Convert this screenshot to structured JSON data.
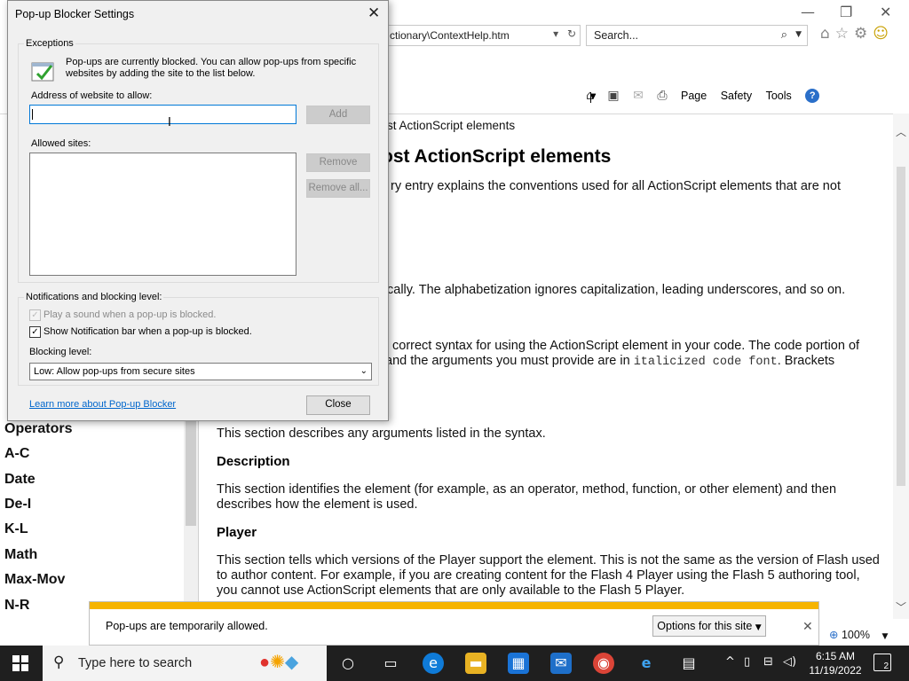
{
  "browser": {
    "address": "ctionary\\ContextHelp.htm",
    "search_placeholder": "Search...",
    "command_bar": {
      "page": "Page",
      "safety": "Safety",
      "tools": "Tools"
    },
    "zoom": "100%"
  },
  "left_nav": {
    "items": [
      "Operators",
      "A-C",
      "Date",
      "De-I",
      "K-L",
      "Math",
      "Max-Mov",
      "N-R"
    ]
  },
  "content": {
    "breadcrumb": "st ActionScript elements",
    "heading": "ost ActionScript elements",
    "p1": "ry entry explains the conventions used for all ActionScript elements that are not",
    "p2": "cally. The alphabetization ignores capitalization, leading underscores, and so on.",
    "p3a": "correct syntax for using the ActionScript element in your code. The code portion of",
    "p3b_pre": "and the arguments you must provide are in ",
    "p3b_code": "italicized code font",
    "p3b_post": ". Brackets",
    "p4": "This section describes any arguments listed in the syntax.",
    "h_description": "Description",
    "p5": "This section identifies the element (for example, as an operator, method, function, or other element) and then describes how the element is used.",
    "h_player": "Player",
    "p6": "This section tells which versions of the Player support the element. This is not the same as the version of Flash used to author content. For example, if you are creating content for the Flash 4 Player using the Flash 5 authoring tool, you cannot use ActionScript elements that are only available to the Flash 5 Player."
  },
  "notification_bar": {
    "message": "Pop-ups are temporarily allowed.",
    "options_button": "Options for this site",
    "accent": "#f6b400"
  },
  "dialog": {
    "title": "Pop-up Blocker Settings",
    "exceptions_label": "Exceptions",
    "info_text": "Pop-ups are currently blocked.  You can allow pop-ups from specific websites by adding the site to the list below.",
    "address_label": "Address of website to allow:",
    "address_value": "",
    "add_button": "Add",
    "allowed_sites_label": "Allowed sites:",
    "allowed_sites": [],
    "remove_button": "Remove",
    "remove_all_button": "Remove all...",
    "notifications_label": "Notifications and blocking level:",
    "play_sound_label": "Play a sound when a pop-up is blocked.",
    "play_sound_checked": true,
    "show_bar_label": "Show Notification bar when a pop-up is blocked.",
    "show_bar_checked": true,
    "blocking_level_label": "Blocking level:",
    "blocking_level_value": "Low: Allow pop-ups from secure sites",
    "learn_more_link": "Learn more about Pop-up Blocker",
    "close_button": "Close"
  },
  "taskbar": {
    "search_placeholder": "Type here to search",
    "time": "6:15 AM",
    "date": "11/19/2022",
    "notification_count": "2"
  }
}
